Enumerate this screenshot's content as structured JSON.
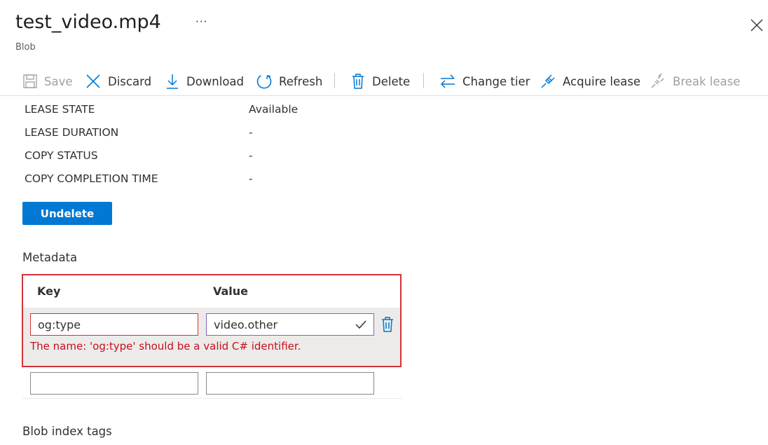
{
  "header": {
    "title": "test_video.mp4",
    "more": "···",
    "subtitle": "Blob"
  },
  "toolbar": {
    "save": "Save",
    "discard": "Discard",
    "download": "Download",
    "refresh": "Refresh",
    "delete": "Delete",
    "change_tier": "Change tier",
    "acquire_lease": "Acquire lease",
    "break_lease": "Break lease"
  },
  "properties": [
    {
      "label": "LEASE STATE",
      "value": "Available"
    },
    {
      "label": "LEASE DURATION",
      "value": "-"
    },
    {
      "label": "COPY STATUS",
      "value": "-"
    },
    {
      "label": "COPY COMPLETION TIME",
      "value": "-"
    }
  ],
  "undelete_label": "Undelete",
  "metadata": {
    "section_title": "Metadata",
    "key_header": "Key",
    "value_header": "Value",
    "rows": [
      {
        "key": "og:type",
        "value": "video.other",
        "error": "The name: 'og:type' should be a valid C# identifier."
      }
    ],
    "empty_key": "",
    "empty_value": ""
  },
  "blob_index_tags_title": "Blob index tags",
  "colors": {
    "accent": "#0078d4",
    "error": "#d13438",
    "focus": "#8661c5"
  }
}
